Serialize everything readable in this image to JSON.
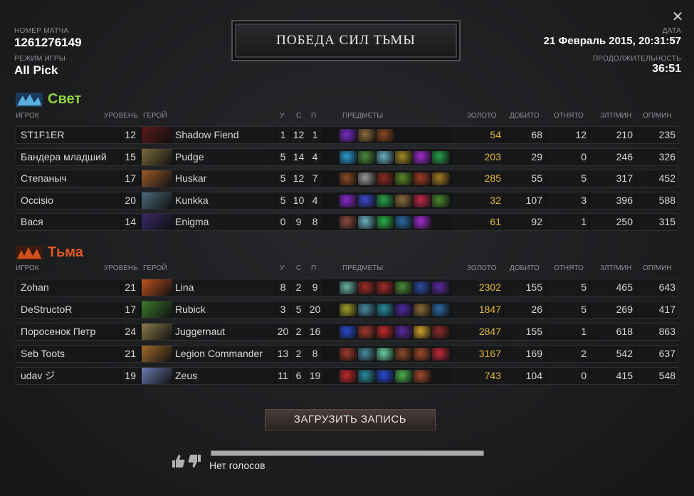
{
  "header": {
    "match_id_label": "НОМЕР МАТЧА",
    "match_id": "1261276149",
    "game_mode_label": "РЕЖИМ ИГРЫ",
    "game_mode": "All Pick",
    "title": "ПОБЕДА СИЛ ТЬМЫ",
    "date_label": "ДАТА",
    "date": "21 Февраль 2015, 20:31:57",
    "duration_label": "ПРОДОЛЖИТЕЛЬНОСТЬ",
    "duration": "36:51",
    "close_icon": "close-icon"
  },
  "columns": {
    "player": "ИГРОК",
    "level": "УРОВЕНЬ",
    "hero": "ГЕРОЙ",
    "kills": "У",
    "deaths": "С",
    "assists": "П",
    "items": "ПРЕДМЕТЫ",
    "gold": "ЗОЛОТО",
    "last_hits": "ДОБИТО",
    "denies": "ОТНЯТО",
    "gpm": "ЗЛТ/МИН",
    "xpm": "ОП/МИН"
  },
  "radiant": {
    "name": "Свет",
    "color": "#8fd23a",
    "players": [
      {
        "player": "ST1F1ER",
        "level": "12",
        "hero": "Shadow Fiend",
        "hero_color": "#5a1818",
        "k": "1",
        "d": "12",
        "a": "1",
        "items": [
          "#7a2cc8",
          "#8a6a3a",
          "#8a4a22"
        ],
        "gold": "54",
        "lh": "68",
        "dn": "12",
        "gpm": "210",
        "xpm": "235"
      },
      {
        "player": "Бандера младший",
        "level": "15",
        "hero": "Pudge",
        "hero_color": "#7a6a3a",
        "k": "5",
        "d": "14",
        "a": "4",
        "items": [
          "#2a9ad0",
          "#4a8a3a",
          "#6ab0c0",
          "#a08a2a",
          "#a02ad0",
          "#2aa04a"
        ],
        "gold": "203",
        "lh": "29",
        "dn": "0",
        "gpm": "246",
        "xpm": "326"
      },
      {
        "player": "Степаныч",
        "level": "17",
        "hero": "Huskar",
        "hero_color": "#9a5a2a",
        "k": "5",
        "d": "12",
        "a": "7",
        "items": [
          "#8a4a22",
          "#9a9a9a",
          "#8a2a22",
          "#5a8a2a",
          "#a03a22",
          "#a07a22"
        ],
        "gold": "285",
        "lh": "55",
        "dn": "5",
        "gpm": "317",
        "xpm": "452"
      },
      {
        "player": "Occisio",
        "level": "20",
        "hero": "Kunkka",
        "hero_color": "#4a6a7a",
        "k": "5",
        "d": "10",
        "a": "4",
        "items": [
          "#8a2ad0",
          "#3a4ad0",
          "#2aa04a",
          "#8a6a3a",
          "#c02a4a",
          "#4a8a2a"
        ],
        "gold": "32",
        "lh": "107",
        "dn": "3",
        "gpm": "396",
        "xpm": "588"
      },
      {
        "player": "Вася",
        "level": "14",
        "hero": "Enigma",
        "hero_color": "#3a2a6a",
        "k": "0",
        "d": "9",
        "a": "8",
        "items": [
          "#8a4a3a",
          "#6ab0c0",
          "#2ab04a",
          "#2a6aa0",
          "#a02ad0"
        ],
        "gold": "61",
        "lh": "92",
        "dn": "1",
        "gpm": "250",
        "xpm": "315"
      }
    ]
  },
  "dire": {
    "name": "Тьма",
    "color": "#e05a1e",
    "players": [
      {
        "player": "Zohan",
        "level": "21",
        "hero": "Lina",
        "hero_color": "#c0521e",
        "k": "8",
        "d": "2",
        "a": "9",
        "items": [
          "#6ab0a0",
          "#a02a2a",
          "#a02a2a",
          "#4a8a3a",
          "#2a4aa0",
          "#5a2aa0"
        ],
        "gold": "2302",
        "lh": "155",
        "dn": "5",
        "gpm": "465",
        "xpm": "643"
      },
      {
        "player": "DeStructoR",
        "level": "17",
        "hero": "Rubick",
        "hero_color": "#3a7a2a",
        "k": "3",
        "d": "5",
        "a": "20",
        "items": [
          "#a0a02a",
          "#4a8aa0",
          "#2a8aa0",
          "#4a2aa0",
          "#8a6a3a",
          "#2a6aa0"
        ],
        "gold": "1847",
        "lh": "26",
        "dn": "5",
        "gpm": "269",
        "xpm": "417"
      },
      {
        "player": "Поросенок Петр",
        "level": "24",
        "hero": "Juggernaut",
        "hero_color": "#8a7a4a",
        "k": "20",
        "d": "2",
        "a": "16",
        "items": [
          "#2a4ad0",
          "#a03a2a",
          "#c02a2a",
          "#5a2aa0",
          "#d0a02a",
          "#8a2a2a"
        ],
        "gold": "2847",
        "lh": "155",
        "dn": "1",
        "gpm": "618",
        "xpm": "863"
      },
      {
        "player": "Seb Toots",
        "level": "21",
        "hero": "Legion Commander",
        "hero_color": "#a06a2a",
        "k": "13",
        "d": "2",
        "a": "8",
        "items": [
          "#a03a2a",
          "#4a8aa0",
          "#6ad0a0",
          "#8a4a2a",
          "#a04a2a",
          "#c02a3a"
        ],
        "gold": "3167",
        "lh": "169",
        "dn": "2",
        "gpm": "542",
        "xpm": "637"
      },
      {
        "player": "udav ジ",
        "level": "19",
        "hero": "Zeus",
        "hero_color": "#6a7ab0",
        "k": "11",
        "d": "6",
        "a": "19",
        "items": [
          "#c02a2a",
          "#2a8aa0",
          "#2a4ad0",
          "#4ab04a",
          "#a04a2a"
        ],
        "gold": "743",
        "lh": "104",
        "dn": "0",
        "gpm": "415",
        "xpm": "548"
      }
    ]
  },
  "footer": {
    "download_label": "ЗАГРУЗИТЬ ЗАПИСЬ",
    "votes_label": "Нет голосов",
    "vote_progress_percent": 100
  }
}
